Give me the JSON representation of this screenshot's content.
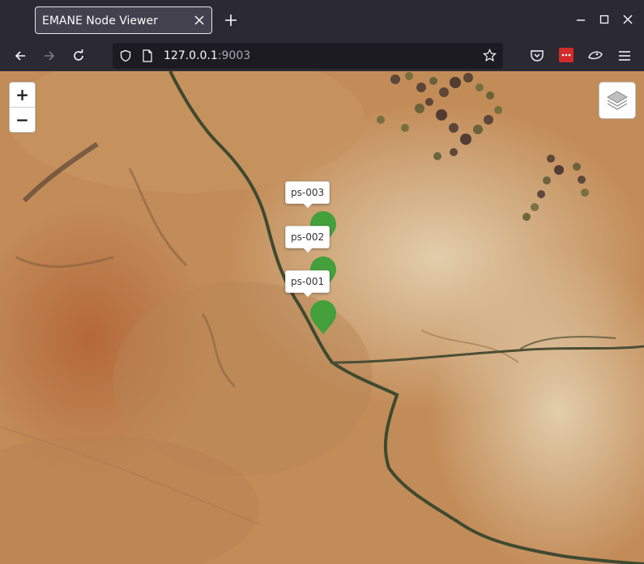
{
  "browser": {
    "tab_title": "EMANE Node Viewer",
    "url_host": "127.0.0.1",
    "url_port": ":9003"
  },
  "map": {
    "zoom_in_label": "+",
    "zoom_out_label": "−",
    "nodes": [
      {
        "label": "ps-003",
        "color": "#43a03a"
      },
      {
        "label": "ps-002",
        "color": "#43a03a"
      },
      {
        "label": "ps-001",
        "color": "#43a03a"
      }
    ]
  }
}
